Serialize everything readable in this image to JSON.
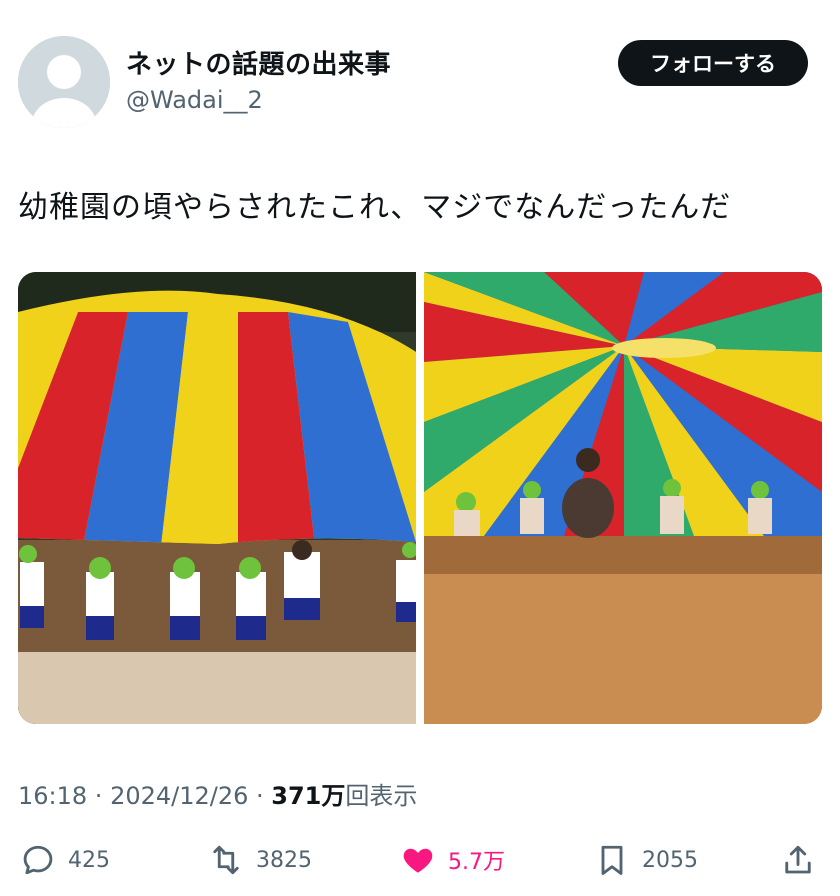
{
  "author": {
    "display_name": "ネットの話題の出来事",
    "handle": "@Wadai__2"
  },
  "follow_button": {
    "label": "フォローする"
  },
  "tweet": {
    "text": "幼稚園の頃やらされたこれ、マジでなんだったんだ"
  },
  "meta": {
    "time": "16:18",
    "separator": " · ",
    "date": "2024/12/26",
    "views_count": "371万",
    "views_label": "回表示"
  },
  "actions": {
    "reply_count": "425",
    "retweet_count": "3825",
    "like_count": "5.7万",
    "bookmark_count": "2055"
  },
  "colors": {
    "text": "#0f1419",
    "secondary": "#536471",
    "like": "#f91880",
    "button_bg": "#0f1419"
  },
  "icons": [
    "default-avatar-icon",
    "reply-icon",
    "retweet-icon",
    "heart-filled-icon",
    "bookmark-icon",
    "share-icon"
  ]
}
